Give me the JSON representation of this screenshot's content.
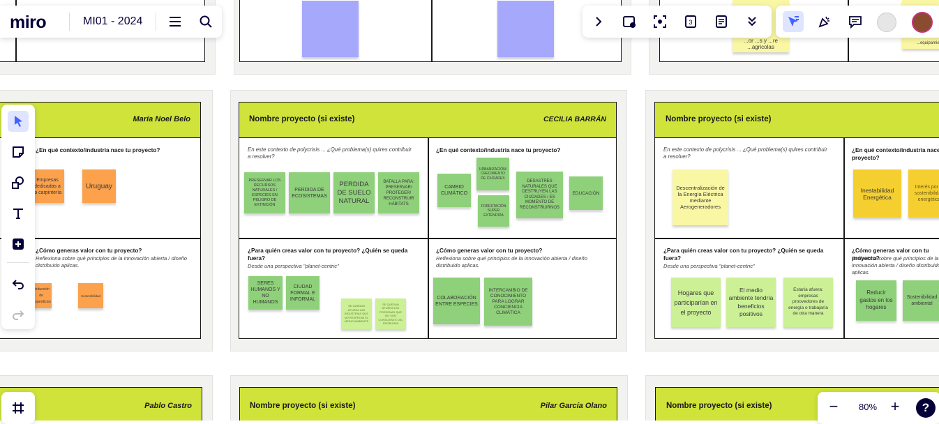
{
  "app": {
    "logo": "miro",
    "board_name": "MI01 - 2024"
  },
  "zoom": {
    "level": "80%",
    "minus": "−",
    "plus": "+",
    "help": "?"
  },
  "board_a": {
    "person": "María Noel Belo",
    "q2": "¿En qué contexto/industria nace tu proyecto?",
    "q4": "¿Cómo generas valor con tu proyecto?",
    "q4_sub": "Reflexiona sobre qué principios de la innovación abierta / diseño distribuido aplicas.",
    "notes": [
      "Empresas dedicadas a la carpintería",
      "Uruguay",
      "Reducción de desperdicios",
      "Sostenibilidad"
    ]
  },
  "board_b": {
    "project": "Nombre proyecto (si existe)",
    "person": "CECILIA BARRÁN",
    "q1": "En este contexto de polycrisis ... ¿Qué problema(s) quires contribuir a resolver?",
    "q2": "¿En qué contexto/industria nace tu proyecto?",
    "q3": "¿Para quién creas valor con tu proyecto? ¿Quién se queda fuera?",
    "q3_sub": "Desde una perspectiva \"planet-centric\"",
    "q4": "¿Cómo generas valor con tu proyecto?",
    "q4_sub": "Reflexiona sobre qué principios de la innovación abierta / diseño distribuido aplicas.",
    "notes": [
      "PRESERVAR LOS RECURSOS NATURALES / ESPECIES EN PELIGRO DE EXTINCIÓN",
      "PERDIDA DE ECOSISTEMAS",
      "PERDIDA DE SUELO NATURAL",
      "BATALLA PARA: PRESERVAR/ PROTEGER/ RECONSTRUIR HÁBITATS",
      "CAMBIO CLIMÁTICO",
      "URBANIZACIÓN/ CRECIMIENTO DE CIUDADES",
      "FORESTACIÓN SUPER EXTENDIDA",
      "DESASTRES NATURALES QUE DESTRUYEN LAS CIUDADES / ES MOMENTO DE RECONSTRUIRNOS",
      "EDUCACIÓN",
      "SERES HUMANOS Y NO HUMANOS",
      "CIUDAD FORMAL E INFORMAL",
      "SE QUEDAN AFUERA LAS INDUSTRIAS QUE NO RESPETAN EL MEDIO AMBIENTE",
      "SE QUEDAN AFUERA LAS PERSONAS QUE NO SON CONSCIENTE DEL PROBLEMA",
      "COLABORACIÓN ENTRE ESPECIES",
      "INTERCAMBIO DE CONOCIMIENTO PARA LOGRAR CONCIENCIA CLIMÁTICA"
    ]
  },
  "board_c": {
    "project": "Nombre proyecto (si existe)",
    "q1": "En este contexto de polycrisis ... ¿Qué problema(s) quires contribuir a resolver?",
    "q2": "¿En qué contexto/industria nace tu proyecto?",
    "q3": "¿Para quién creas valor con tu proyecto? ¿Quién se queda fuera?",
    "q3_sub": "Desde una perspectiva \"planet-centric\"",
    "q4": "¿Cómo generas valor con tu proyecto?",
    "q4_sub": "Reflexiona sobre qué principios de la innovación abierta / diseño distribuido aplicas.",
    "notes": [
      "Descentralización de la Energía Eléctrica mediante Aerogeneradores",
      "Inestabilidad Energética",
      "Interés por la sostenibilidad energética",
      "Hogares que participarían en el proyecto",
      "El medio ambiente tendría beneficios positivos",
      "Estaría afuera: empresas proovedores de energía o trabajaría de otra manera",
      "Reducir gastos en los hogares",
      "Sostenibilidad ambiental"
    ]
  },
  "board_d": {
    "person": "Pablo Castro"
  },
  "board_e": {
    "project": "Nombre proyecto (si existe)",
    "person": "Pilar García Olano"
  },
  "board_f": {
    "project": "Nombre proyecto (si existe)"
  },
  "top_notes": [
    "...or ...s y ...re ...agricolas",
    "...equipamien"
  ],
  "colors": {
    "header": "#cfe33b",
    "green_note": "#8fd07a",
    "yellow_note": "#f9f7a3",
    "orange_note": "#fca14c",
    "purple_note": "#a6a8fb",
    "accent": "#4262ff"
  }
}
